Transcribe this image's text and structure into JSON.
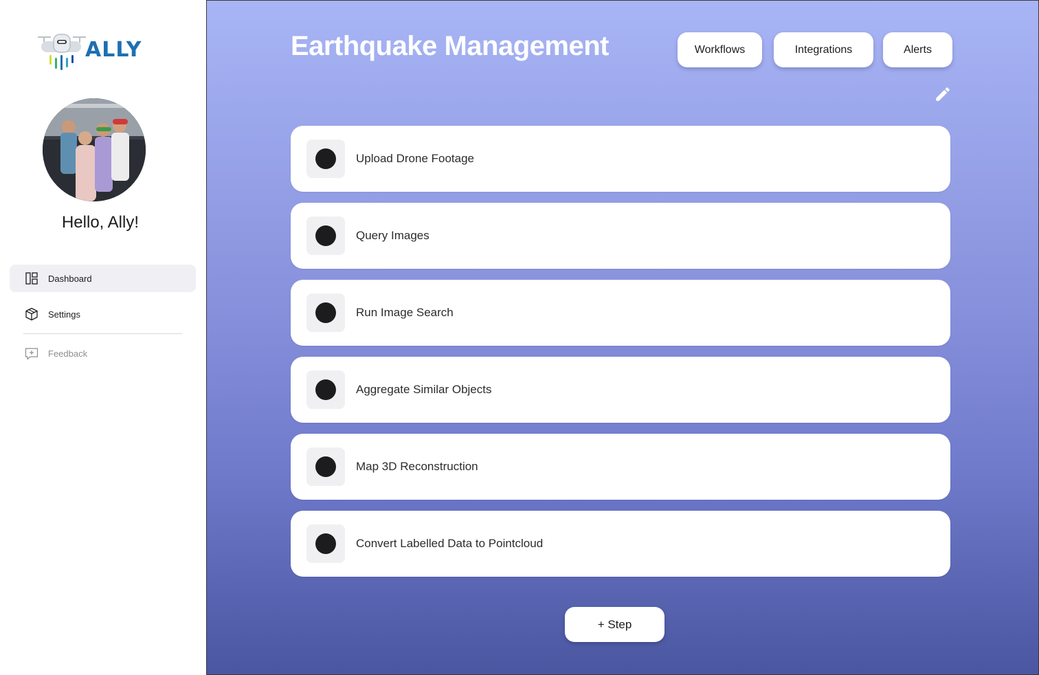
{
  "sidebar": {
    "logo_text": "ALLY",
    "greeting": "Hello, Ally!",
    "nav": [
      {
        "label": "Dashboard",
        "icon": "dashboard-icon",
        "active": true
      },
      {
        "label": "Settings",
        "icon": "cube-icon",
        "active": false
      }
    ],
    "feedback_label": "Feedback"
  },
  "header": {
    "title": "Earthquake Management",
    "buttons": {
      "workflows": "Workflows",
      "integrations": "Integrations",
      "alerts": "Alerts"
    }
  },
  "steps": [
    "Upload Drone Footage",
    "Query Images",
    "Run Image Search",
    "Aggregate Similar Objects",
    "Map 3D Reconstruction",
    "Convert Labelled Data to Pointcloud"
  ],
  "add_step_label": "+ Step",
  "colors": {
    "accent": "#1f6fb2",
    "gradient_top": "#a8b5f5",
    "gradient_bottom": "#4a56a0",
    "step_dot": "#1c1c1e"
  }
}
